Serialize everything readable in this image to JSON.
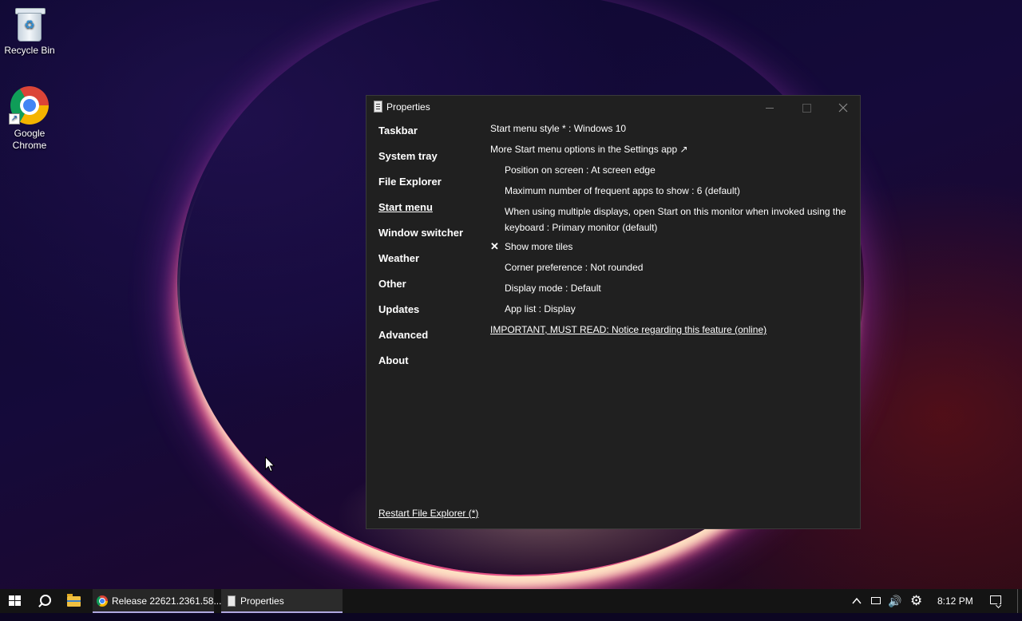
{
  "desktop": {
    "icons": [
      {
        "label": "Recycle Bin"
      },
      {
        "label": "Google Chrome"
      }
    ]
  },
  "window": {
    "title": "Properties",
    "nav": [
      {
        "label": "Taskbar",
        "active": false
      },
      {
        "label": "System tray",
        "active": false
      },
      {
        "label": "File Explorer",
        "active": false
      },
      {
        "label": "Start menu",
        "active": true
      },
      {
        "label": "Window switcher",
        "active": false
      },
      {
        "label": "Weather",
        "active": false
      },
      {
        "label": "Other",
        "active": false
      },
      {
        "label": "Updates",
        "active": false
      },
      {
        "label": "Advanced",
        "active": false
      },
      {
        "label": "About",
        "active": false
      }
    ],
    "restart_link": "Restart File Explorer (*)",
    "settings": {
      "start_menu_style": "Start menu style * : Windows 10",
      "more_options": "More Start menu options in the Settings app ↗",
      "position": "Position on screen : At screen edge",
      "max_frequent": "Maximum number of frequent apps to show : 6 (default)",
      "multi_display": "When using multiple displays, open Start on this monitor when invoked using the keyboard : Primary monitor (default)",
      "show_more_tiles": "Show more tiles",
      "show_more_tiles_mark": "✕",
      "corner_preference": "Corner preference : Not rounded",
      "display_mode": "Display mode : Default",
      "app_list": "App list : Display",
      "important_notice": "IMPORTANT, MUST READ: Notice regarding this feature (online)"
    }
  },
  "taskbar": {
    "apps": [
      {
        "label": "Release 22621.2361.58..."
      },
      {
        "label": "Properties"
      }
    ],
    "clock": "8:12 PM",
    "tray_chevron": "^",
    "volume_glyph": "🔊",
    "gear_glyph": "⚙",
    "accent": "#b0a8e0"
  }
}
